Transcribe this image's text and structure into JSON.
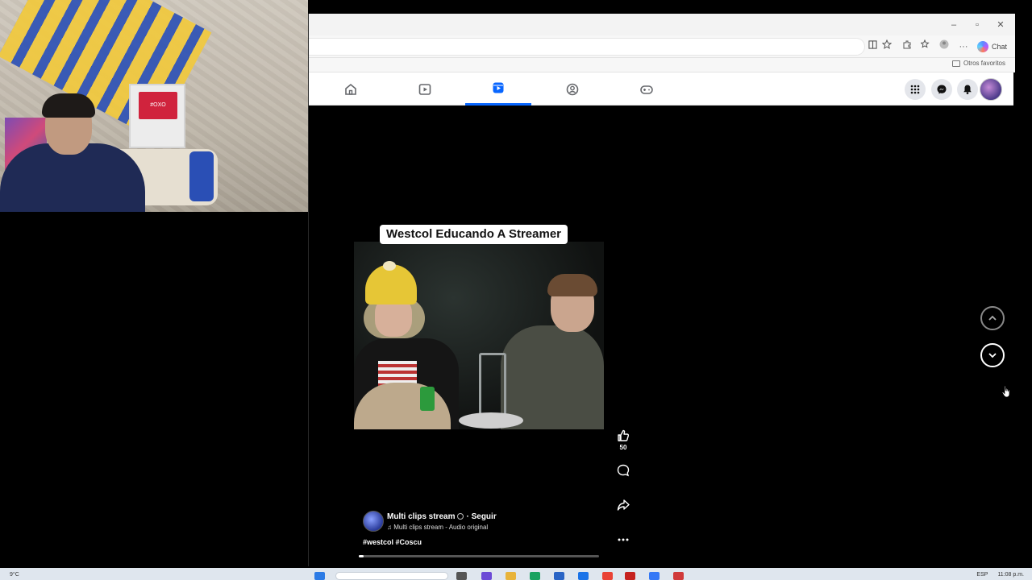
{
  "webcam": {
    "sign_text": "#OXO"
  },
  "browser": {
    "window_controls": {
      "minimize": "–",
      "maximize": "▫",
      "close": "✕"
    },
    "toolbar": {
      "chat_label": "Chat",
      "more_label": "···"
    },
    "favorites": {
      "other_label": "Otros favoritos"
    }
  },
  "facebook": {
    "tabs": [
      {
        "name": "home",
        "active": false
      },
      {
        "name": "watch",
        "active": false
      },
      {
        "name": "reels",
        "active": true
      },
      {
        "name": "groups",
        "active": false
      },
      {
        "name": "gaming",
        "active": false
      }
    ]
  },
  "reel": {
    "title": "Westcol Educando A Streamer",
    "like_count": "50",
    "author": "Multi clips stream",
    "separator": "·",
    "follow_label": "Seguir",
    "audio": "Multi clips stream - Audio original",
    "hashtags": "#westcol #Coscu",
    "progress": 0.02
  },
  "taskbar": {
    "weather": "9°C",
    "language": "ESP",
    "time": "11:08 p.m."
  },
  "colors": {
    "fb_blue": "#0866ff",
    "page_bg": "#000000"
  }
}
